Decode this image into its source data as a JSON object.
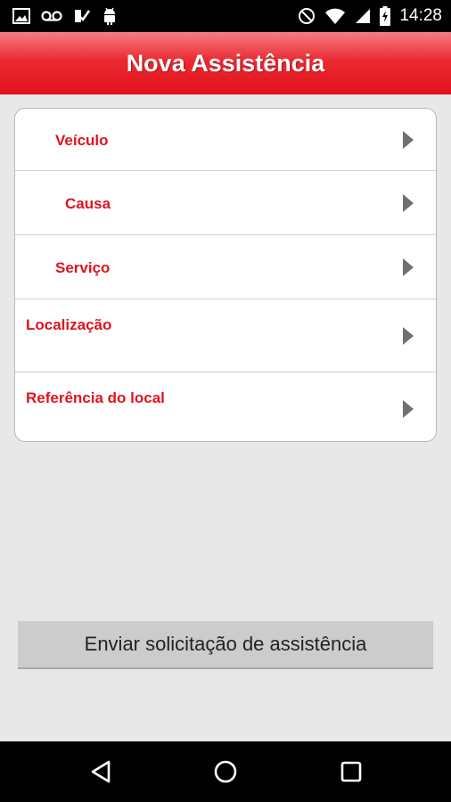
{
  "status_bar": {
    "time": "14:28",
    "left_icons": [
      "image-icon",
      "voicemail-icon",
      "checklist-icon",
      "android-icon"
    ],
    "right_icons": [
      "do-not-disturb-icon",
      "wifi-icon",
      "signal-icon",
      "battery-charging-icon"
    ]
  },
  "header": {
    "title": "Nova Assistência"
  },
  "menu": {
    "items": [
      {
        "label": "Veículo"
      },
      {
        "label": "Causa"
      },
      {
        "label": "Serviço"
      },
      {
        "label": "Localização"
      },
      {
        "label": "Referência do local"
      }
    ]
  },
  "submit": {
    "label": "Enviar solicitação de assistência"
  },
  "nav_bar": {
    "buttons": [
      "back-icon",
      "home-icon",
      "recents-icon"
    ]
  },
  "colors": {
    "accent": "#e0141e",
    "header_red": "#ec2a33",
    "background": "#e8e8e8"
  }
}
